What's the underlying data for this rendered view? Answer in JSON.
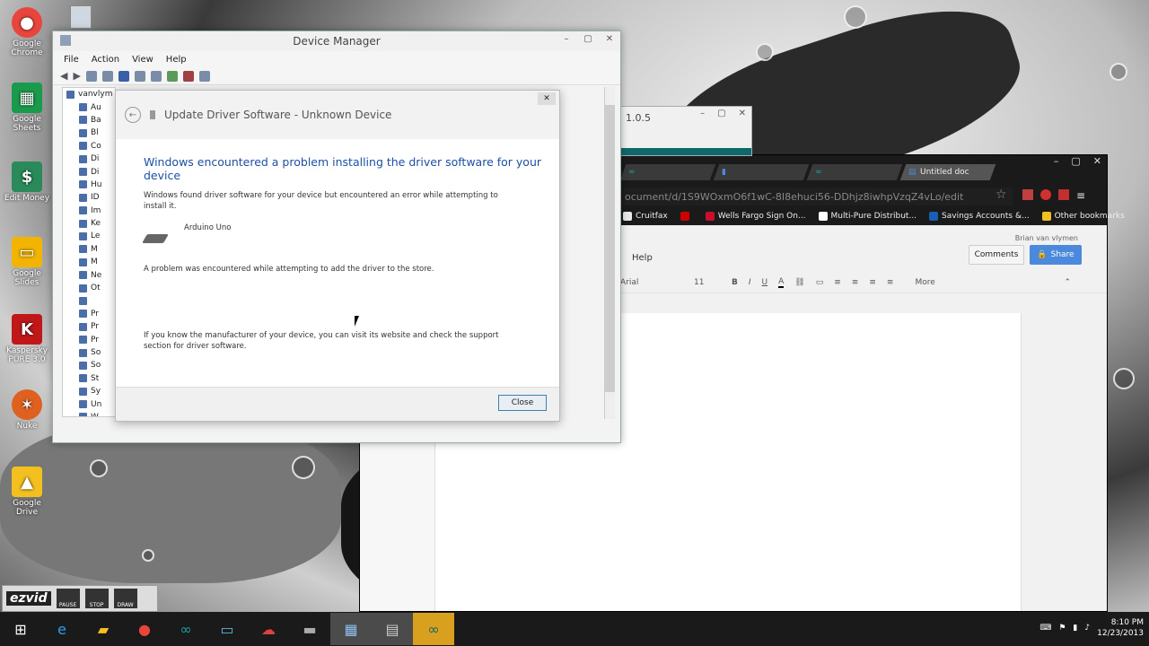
{
  "desktop": {
    "icons": [
      {
        "label": "Google Chrome",
        "icon": "chrome-icon",
        "color": "#e8453c"
      },
      {
        "label": "Google Sheets",
        "icon": "sheets-icon",
        "color": "#1a9a4c"
      },
      {
        "label": "Edit Money",
        "icon": "money-icon",
        "color": "#2a8a5a"
      },
      {
        "label": "Google Slides",
        "icon": "slides-icon",
        "color": "#f2b400"
      },
      {
        "label": "Kaspersky PURE 3.0",
        "icon": "kaspersky-icon",
        "color": "#c01818"
      },
      {
        "label": "Nuke",
        "icon": "nuke-icon",
        "color": "#e06020"
      },
      {
        "label": "Google Drive",
        "icon": "drive-icon",
        "color": "#f4c020"
      }
    ]
  },
  "device_manager": {
    "title": "Device Manager",
    "menu": [
      "File",
      "Action",
      "View",
      "Help"
    ],
    "tree_items": [
      "vanvlym",
      "Au",
      "Ba",
      "Bl",
      "Co",
      "Di",
      "Di",
      "Hu",
      "ID",
      "Im",
      "Ke",
      "Le",
      "M",
      "M",
      "Ne",
      "Ot",
      "",
      "Pr",
      "Pr",
      "Pr",
      "So",
      "So",
      "St",
      "Sy",
      "Un",
      "W"
    ]
  },
  "dialog": {
    "title": "Update Driver Software - Unknown Device",
    "heading": "Windows encountered a problem installing the driver software for your device",
    "para1": "Windows found driver software for your device but encountered an error while attempting to install it.",
    "device_name": "Arduino Uno",
    "para2": "A problem was encountered while attempting to add the driver to the store.",
    "para3": "If you know the manufacturer of your device, you can visit its website and check the support section for driver software.",
    "close_label": "Close"
  },
  "arduino_window": {
    "title": "1.0.5"
  },
  "chrome": {
    "tabs": [
      "",
      "",
      "",
      "Untitled doc"
    ],
    "url": "ocument/d/1S9WOxmO6f1wC-8I8ehuci56-DDhjz8iwhpVzqZ4vLo/edit",
    "bookmarks": [
      {
        "label": "Cruitfax",
        "color": "#e8e8e8"
      },
      {
        "label": "",
        "color": "#cc0000"
      },
      {
        "label": "Wells Fargo Sign On...",
        "color": "#c8102e"
      },
      {
        "label": "Multi-Pure Distribut...",
        "color": "#ffffff"
      },
      {
        "label": "Savings Accounts &...",
        "color": "#1a5fb4"
      },
      {
        "label": "Other bookmarks",
        "color": "#f4c020"
      }
    ],
    "docs": {
      "menu_help": "Help",
      "user": "Brian van vlymen",
      "comments_label": "Comments",
      "share_label": "Share",
      "font": "Arial",
      "font_size": "11",
      "more_label": "More"
    }
  },
  "ezvid": {
    "logo": "ezvid",
    "buttons": [
      "PAUSE",
      "STOP",
      "DRAW"
    ]
  },
  "taskbar": {
    "apps": [
      "start-icon",
      "ie-icon",
      "explorer-icon",
      "chrome-icon",
      "arduino-icon",
      "monitor-icon",
      "cloud-icon",
      "terminal-icon",
      "device-manager-icon",
      "drive-tool-icon",
      "arduino-ide-icon"
    ],
    "time": "8:10 PM",
    "date": "12/23/2013"
  }
}
